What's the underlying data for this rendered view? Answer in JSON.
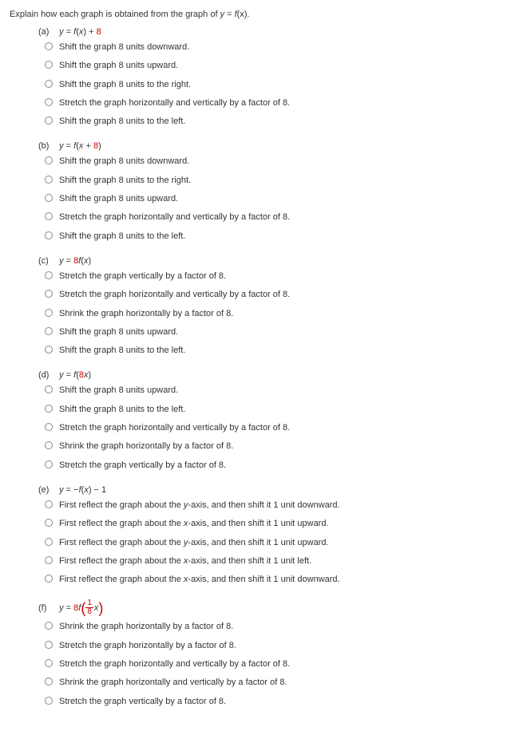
{
  "intro": {
    "prefix": "Explain how each graph is obtained from the graph of ",
    "eq_lhs": "y",
    "eq_rhs_f": "f",
    "eq_rhs_x": "(x)",
    "suffix": "."
  },
  "questions": [
    {
      "label": "(a)",
      "eq_html": "<span class=\"italic\">y</span> = <span class=\"italic\">f</span>(<span class=\"italic\">x</span>) + <span class=\"red\">8</span>",
      "options": [
        "Shift the graph 8 units downward.",
        "Shift the graph 8 units upward.",
        "Shift the graph 8 units to the right.",
        "Stretch the graph horizontally and vertically by a factor of 8.",
        "Shift the graph 8 units to the left."
      ]
    },
    {
      "label": "(b)",
      "eq_html": "<span class=\"italic\">y</span> = <span class=\"italic\">f</span>(<span class=\"italic\">x</span> + <span class=\"red\">8</span>)",
      "options": [
        "Shift the graph 8 units downward.",
        "Shift the graph 8 units to the right.",
        "Shift the graph 8 units upward.",
        "Stretch the graph horizontally and vertically by a factor of 8.",
        "Shift the graph 8 units to the left."
      ]
    },
    {
      "label": "(c)",
      "eq_html": "<span class=\"italic\">y</span> = <span class=\"red\">8</span><span class=\"italic\">f</span>(<span class=\"italic\">x</span>)",
      "options": [
        "Stretch the graph vertically by a factor of 8.",
        "Stretch the graph horizontally and vertically by a factor of 8.",
        "Shrink the graph horizontally by a factor of 8.",
        "Shift the graph 8 units upward.",
        "Shift the graph 8 units to the left."
      ]
    },
    {
      "label": "(d)",
      "eq_html": "<span class=\"italic\">y</span> = <span class=\"italic\">f</span>(<span class=\"red\">8</span><span class=\"italic\">x</span>)",
      "options": [
        "Shift the graph 8 units upward.",
        "Shift the graph 8 units to the left.",
        "Stretch the graph horizontally and vertically by a factor of 8.",
        "Shrink the graph horizontally by a factor of 8.",
        "Stretch the graph vertically by a factor of 8."
      ]
    },
    {
      "label": "(e)",
      "eq_html": "<span class=\"italic\">y</span> = −<span class=\"italic\">f</span>(<span class=\"italic\">x</span>) − 1",
      "options": [
        "First reflect the graph about the <span class=\"italic\">y</span>-axis, and then shift it 1 unit downward.",
        "First reflect the graph about the <span class=\"italic\">x</span>-axis, and then shift it 1 unit upward.",
        "First reflect the graph about the <span class=\"italic\">y</span>-axis, and then shift it 1 unit upward.",
        "First reflect the graph about the <span class=\"italic\">x</span>-axis, and then shift it 1 unit left.",
        "First reflect the graph about the <span class=\"italic\">x</span>-axis, and then shift it 1 unit downward."
      ]
    },
    {
      "label": "(f)",
      "eq_html": "<span class=\"italic\">y</span> = <span class=\"red\">8</span><span class=\"italic\">f</span><span class=\"paren-wrap\"><span class=\"big-paren\">(</span><span class=\"frac red\"><span class=\"num\">1</span><span class=\"den\">8</span></span><span class=\"italic\" style=\"margin-left:1px;\">x</span><span class=\"big-paren\">)</span></span>",
      "options": [
        "Shrink the graph horizontally by a factor of 8.",
        "Stretch the graph horizontally by a factor of 8.",
        "Stretch the graph horizontally and vertically by a factor of 8.",
        "Shrink the graph horizontally and vertically by a factor of 8.",
        "Stretch the graph vertically by a factor of 8."
      ]
    }
  ]
}
